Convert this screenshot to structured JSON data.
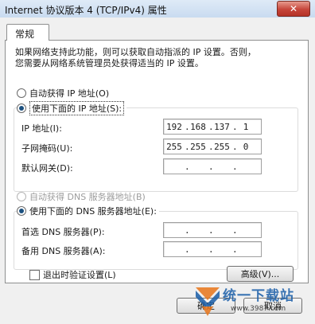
{
  "window": {
    "title": "Internet 协议版本 4 (TCP/IPv4) 属性",
    "close_label": "✕"
  },
  "tabs": [
    {
      "label": "常规"
    }
  ],
  "description": {
    "line1": "如果网络支持此功能，则可以获取自动指派的 IP 设置。否则，",
    "line2": "您需要从网络系统管理员处获得适当的 IP 设置。"
  },
  "ip_mode": {
    "auto_label": "自动获得 IP 地址(O)",
    "manual_label": "使用下面的 IP 地址(S):",
    "selected": "manual"
  },
  "ip_fields": {
    "ip_label": "IP 地址(I):",
    "ip_value": [
      "192",
      "168",
      "137",
      "1"
    ],
    "subnet_label": "子网掩码(U):",
    "subnet_value": [
      "255",
      "255",
      "255",
      "0"
    ],
    "gateway_label": "默认网关(D):",
    "gateway_value": [
      "",
      "",
      "",
      ""
    ]
  },
  "dns_mode": {
    "auto_label": "自动获得 DNS 服务器地址(B)",
    "manual_label": "使用下面的 DNS 服务器地址(E):",
    "selected": "manual"
  },
  "dns_fields": {
    "preferred_label": "首选 DNS 服务器(P):",
    "preferred_value": [
      "",
      "",
      "",
      ""
    ],
    "alternate_label": "备用 DNS 服务器(A):",
    "alternate_value": [
      "",
      "",
      "",
      ""
    ]
  },
  "validate_on_exit": {
    "label": "退出时验证设置(L)",
    "checked": false
  },
  "buttons": {
    "advanced": "高级(V)...",
    "ok": "确定",
    "cancel": "取消"
  },
  "watermark": {
    "text": "统一下载站",
    "url": "www.3987.com"
  },
  "colors": {
    "radio_dot": "#1c5180",
    "titlebar": "#c9dbf0",
    "close_button": "#c6453a"
  }
}
